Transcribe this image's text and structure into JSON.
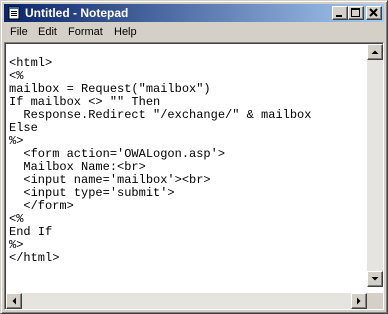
{
  "window": {
    "title": "Untitled - Notepad",
    "icon": "notepad-icon",
    "controls": [
      "minimize-icon",
      "maximize-icon",
      "close-icon"
    ]
  },
  "menu": {
    "items": [
      {
        "label": "File"
      },
      {
        "label": "Edit"
      },
      {
        "label": "Format"
      },
      {
        "label": "Help"
      }
    ]
  },
  "editor": {
    "lines": [
      "<html>",
      "<%",
      "mailbox = Request(\"mailbox\")",
      "If mailbox <> \"\" Then",
      "  Response.Redirect \"/exchange/\" & mailbox",
      "Else",
      "%>",
      "  <form action='OWALogon.asp'>",
      "  Mailbox Name:<br>",
      "  <input name='mailbox'><br>",
      "  <input type='submit'>",
      "  </form>",
      "<%",
      "End If",
      "%>",
      "</html>"
    ]
  },
  "colors": {
    "title_start": "#0a246a",
    "title_end": "#a6caf0",
    "face": "#d4d0c8"
  }
}
